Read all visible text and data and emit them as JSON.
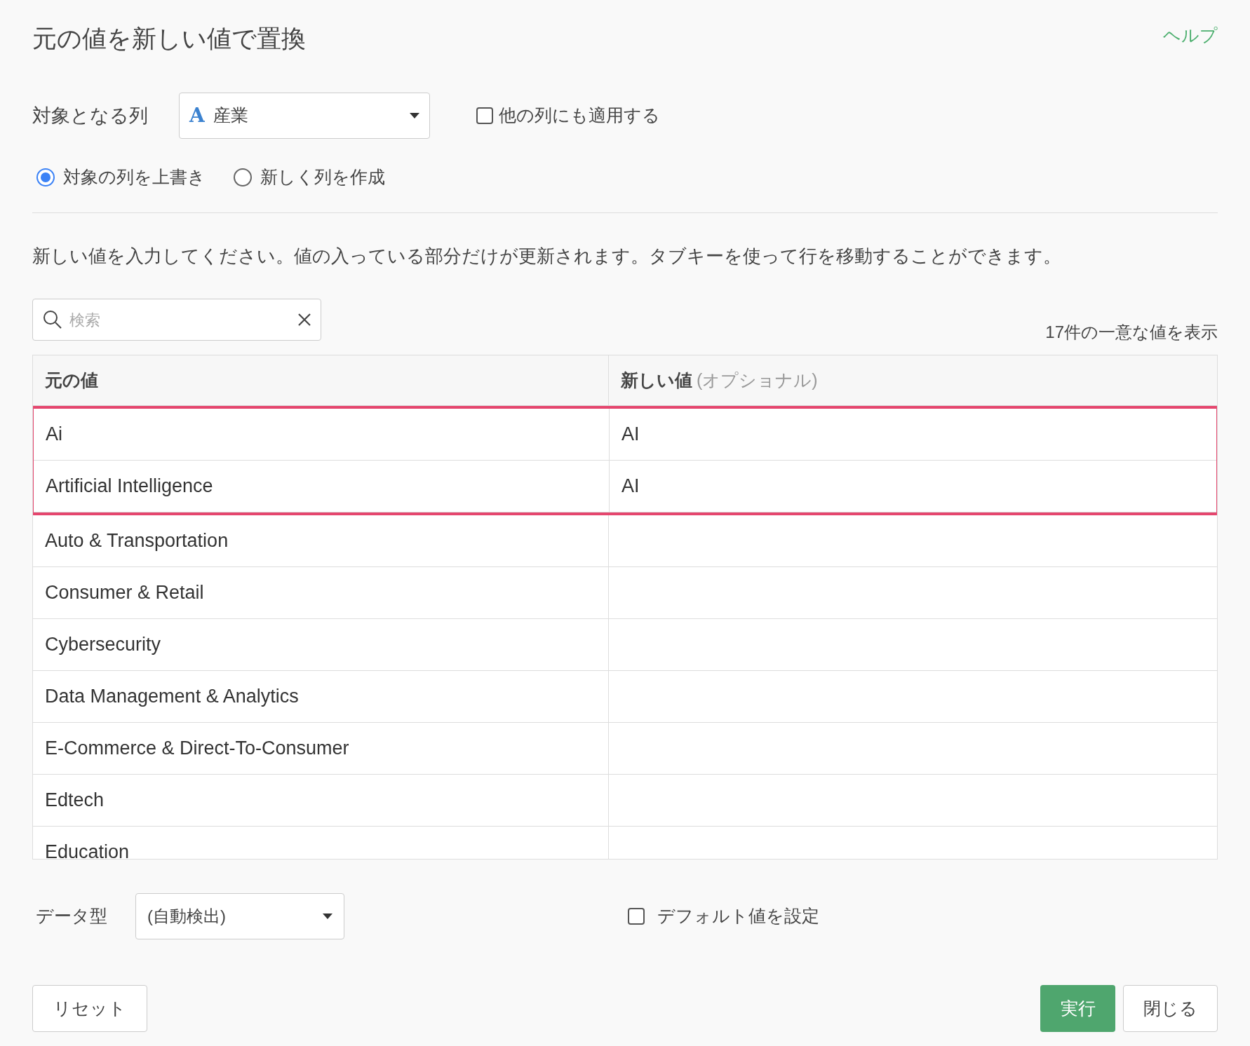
{
  "title": "元の値を新しい値で置換",
  "help_link": "ヘルプ",
  "target_column": {
    "label": "対象となる列",
    "value": "産業",
    "type_icon": "A"
  },
  "apply_other": {
    "label": "他の列にも適用する",
    "checked": false
  },
  "mode_options": [
    {
      "label": "対象の列を上書き",
      "selected": true
    },
    {
      "label": "新しく列を作成",
      "selected": false
    }
  ],
  "instruction": "新しい値を入力してください。値の入っている部分だけが更新されます。タブキーを使って行を移動することができます。",
  "search": {
    "placeholder": "検索"
  },
  "count_text": "17件の一意な値を表示",
  "table": {
    "columns": [
      {
        "label": "元の値"
      },
      {
        "label": "新しい値",
        "note": "(オプショナル)"
      }
    ],
    "rows": [
      {
        "original": "Ai",
        "new_value": "AI",
        "highlighted": true
      },
      {
        "original": "Artificial Intelligence",
        "new_value": "AI",
        "highlighted": true
      },
      {
        "original": "Auto & Transportation",
        "new_value": "",
        "highlighted": false
      },
      {
        "original": "Consumer & Retail",
        "new_value": "",
        "highlighted": false
      },
      {
        "original": "Cybersecurity",
        "new_value": "",
        "highlighted": false
      },
      {
        "original": "Data Management & Analytics",
        "new_value": "",
        "highlighted": false
      },
      {
        "original": "E-Commerce & Direct-To-Consumer",
        "new_value": "",
        "highlighted": false
      },
      {
        "original": "Edtech",
        "new_value": "",
        "highlighted": false
      },
      {
        "original": "Education",
        "new_value": "",
        "highlighted": false
      }
    ]
  },
  "data_type": {
    "label": "データ型",
    "value": "(自動検出)"
  },
  "default_value": {
    "label": "デフォルト値を設定",
    "checked": false
  },
  "buttons": {
    "reset": "リセット",
    "run": "実行",
    "close": "閉じる"
  }
}
